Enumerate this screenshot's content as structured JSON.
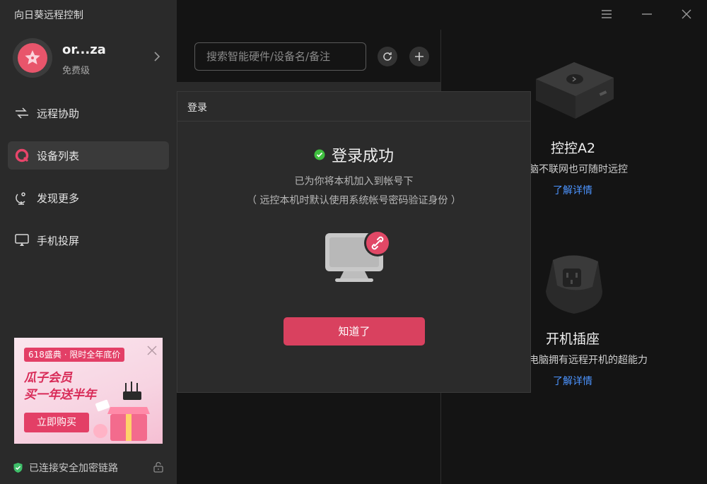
{
  "app": {
    "title": "向日葵远程控制"
  },
  "user": {
    "name": "or...za",
    "level": "免费级"
  },
  "nav": [
    {
      "label": "远程协助",
      "icon": "remote-assist-icon"
    },
    {
      "label": "设备列表",
      "icon": "device-list-icon"
    },
    {
      "label": "发现更多",
      "icon": "discover-icon"
    },
    {
      "label": "手机投屏",
      "icon": "screen-cast-icon"
    }
  ],
  "ad": {
    "tag": "618盛典 · 限时全年底价",
    "line1": "瓜子会员",
    "line2": "买一年送半年",
    "button": "立即购买"
  },
  "footer": {
    "status": "已连接安全加密链路"
  },
  "search": {
    "placeholder": "搜索智能硬件/设备名/备注"
  },
  "products": [
    {
      "name": "控控A2",
      "desc": "脑不联网也可随时远控",
      "link": "了解详情"
    },
    {
      "name": "开机插座",
      "desc": "电脑拥有远程开机的超能力",
      "link": "了解详情"
    }
  ],
  "dialog": {
    "title": "登录",
    "heading": "登录成功",
    "msg1": "已为你将本机加入到帐号下",
    "msg2": "（ 远控本机时默认使用系统帐号密码验证身份 ）",
    "button": "知道了"
  },
  "colors": {
    "accent": "#d9415f",
    "link": "#4c94ff",
    "success": "#3fbf3f"
  }
}
